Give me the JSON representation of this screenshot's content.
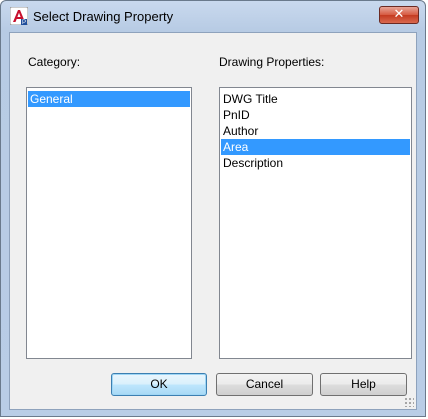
{
  "window": {
    "title": "Select Drawing Property",
    "close_label": "✕"
  },
  "category": {
    "label": "Category:",
    "items": [
      {
        "label": "General",
        "selected": true
      }
    ]
  },
  "properties": {
    "label": "Drawing Properties:",
    "items": [
      {
        "label": "DWG Title",
        "selected": false
      },
      {
        "label": "PnID",
        "selected": false
      },
      {
        "label": "Author",
        "selected": false
      },
      {
        "label": "Area",
        "selected": true
      },
      {
        "label": "Description",
        "selected": false
      }
    ]
  },
  "buttons": {
    "ok": "OK",
    "cancel": "Cancel",
    "help": "Help"
  },
  "colors": {
    "selection": "#3399ff",
    "close_button": "#c43a20",
    "title_bar": "#c9d9ee"
  }
}
